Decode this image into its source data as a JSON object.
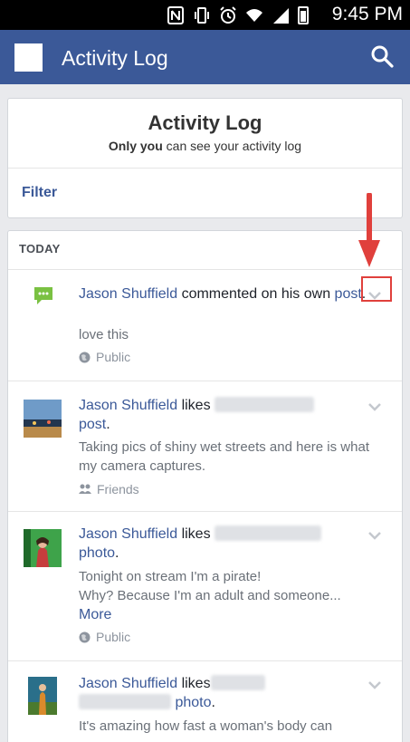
{
  "status_bar": {
    "time": "9:45 PM"
  },
  "app_bar": {
    "title": "Activity Log",
    "icons": [
      "app-logo-icon",
      "search-icon"
    ]
  },
  "header_card": {
    "title": "Activity Log",
    "subtitle_bold": "Only you",
    "subtitle_rest": " can see your activity log",
    "filter_label": "Filter"
  },
  "feed": {
    "section_label": "TODAY",
    "items": [
      {
        "actor": "Jason Shuffield",
        "action": " commented on his own ",
        "object": "post",
        "end": ".",
        "body": "love this",
        "audience": "Public",
        "thumb_icon": "comment-icon"
      },
      {
        "actor": "Jason Shuffield",
        "action": " likes ",
        "object": "post",
        "end": ".",
        "body": "Taking pics of shiny wet streets and here is what my camera captures.",
        "audience": "Friends"
      },
      {
        "actor": "Jason Shuffield",
        "action": " likes ",
        "object": "photo",
        "end": ".",
        "body": "Tonight on stream I'm a pirate!\nWhy? Because I'm an adult and someone...",
        "more": "More",
        "audience": "Public"
      },
      {
        "actor": "Jason Shuffield",
        "action": " likes",
        "object": "photo",
        "end": ".",
        "body": "It's amazing how fast a woman's body can"
      }
    ]
  },
  "colors": {
    "brand": "#3b5998",
    "annotation": "#e0403c"
  }
}
